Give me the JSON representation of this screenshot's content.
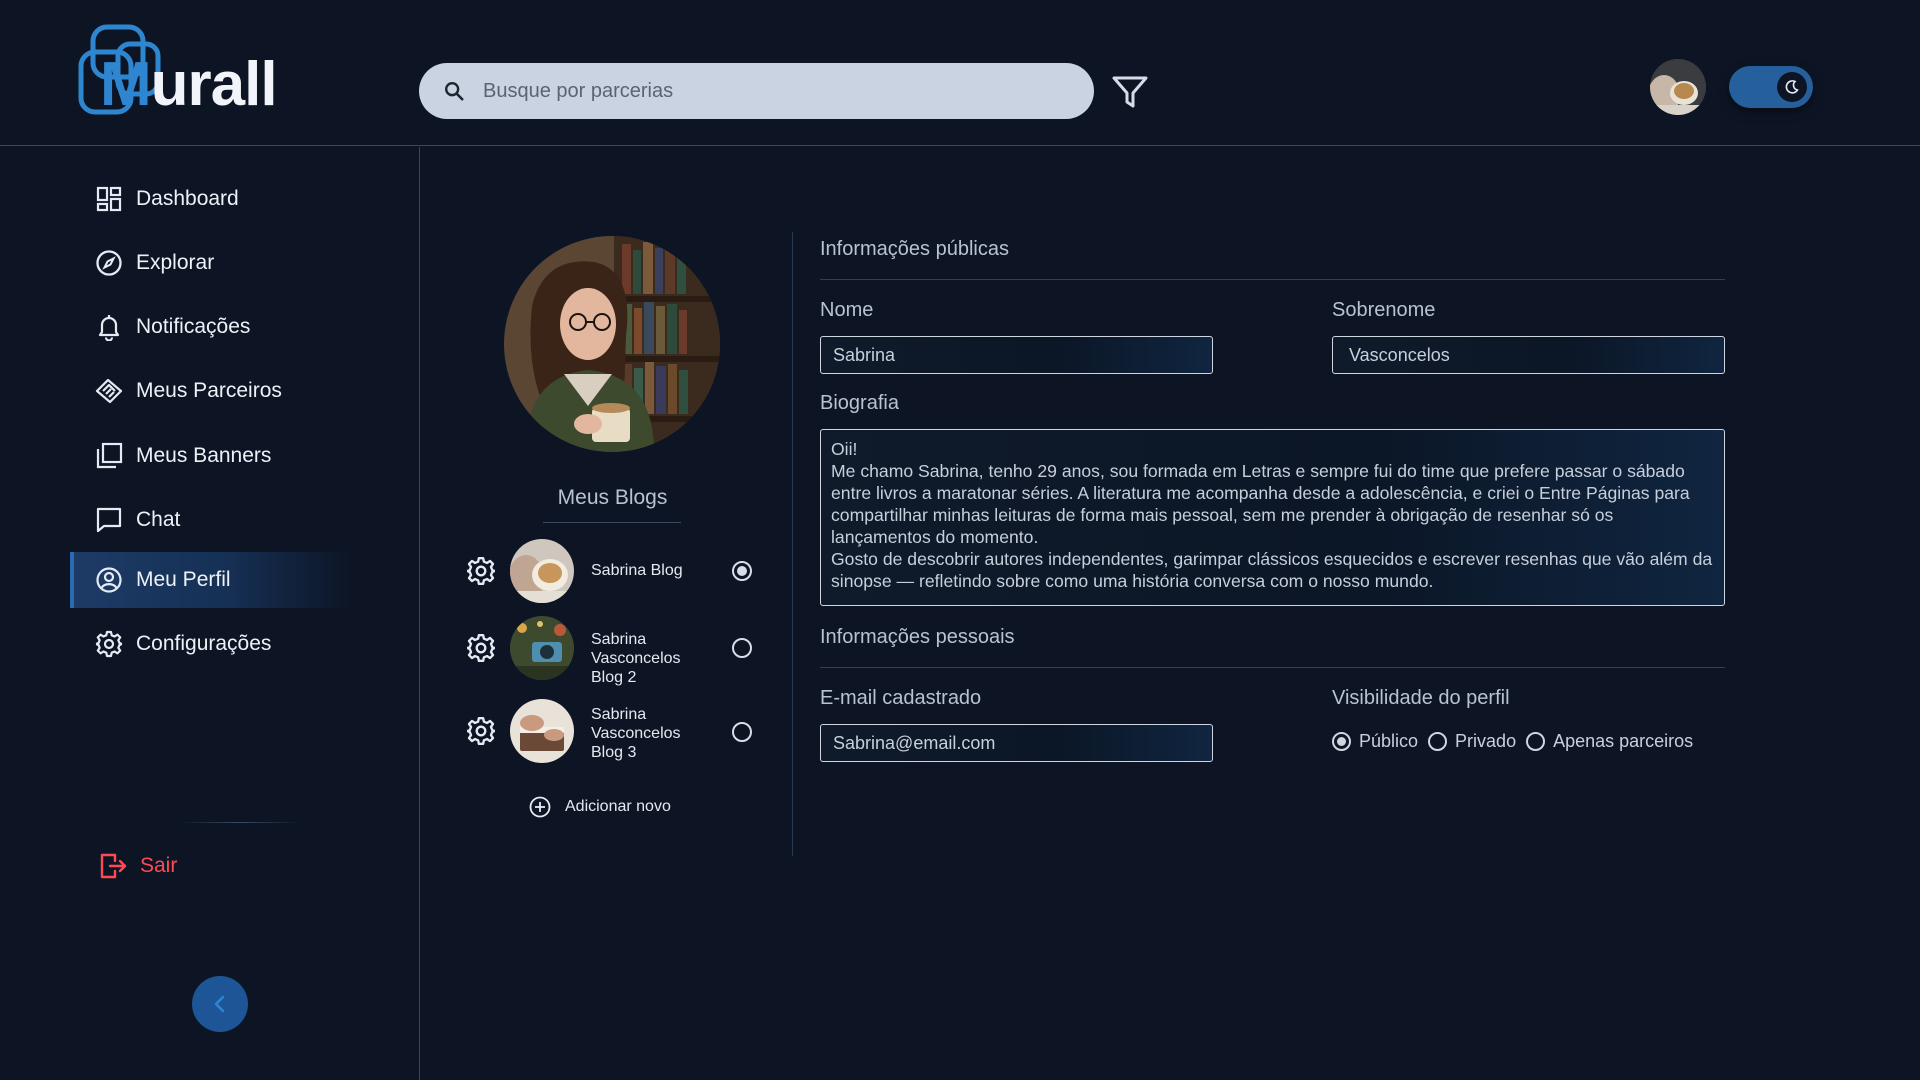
{
  "header": {
    "logo_first": "M",
    "logo_rest": "urall",
    "search_placeholder": "Busque por parcerias"
  },
  "sidebar": {
    "items": [
      {
        "label": "Dashboard",
        "icon": "dashboard-icon"
      },
      {
        "label": "Explorar",
        "icon": "compass-icon"
      },
      {
        "label": "Notificações",
        "icon": "bell-icon"
      },
      {
        "label": "Meus Parceiros",
        "icon": "handshake-icon"
      },
      {
        "label": "Meus Banners",
        "icon": "banners-icon"
      },
      {
        "label": "Chat",
        "icon": "chat-icon"
      },
      {
        "label": "Meu Perfil",
        "icon": "user-circle-icon",
        "active": true
      },
      {
        "label": "Configurações",
        "icon": "gear-icon"
      }
    ],
    "logout_label": "Sair"
  },
  "blogs": {
    "title": "Meus Blogs",
    "items": [
      {
        "name": "Sabrina Blog",
        "selected": true
      },
      {
        "name": "Sabrina Vasconcelos Blog 2",
        "selected": false
      },
      {
        "name": "Sabrina Vasconcelos Blog 3",
        "selected": false
      }
    ],
    "add_label": "Adicionar novo"
  },
  "form": {
    "public_title": "Informações públicas",
    "first_name_label": "Nome",
    "first_name_value": "Sabrina",
    "last_name_label": "Sobrenome",
    "last_name_value": "Vasconcelos",
    "bio_label": "Biografia",
    "bio_value": "Oii!\nMe chamo Sabrina, tenho 29 anos, sou formada em Letras e sempre fui do time que prefere passar o sábado entre livros a maratonar séries. A literatura me acompanha desde a adolescência, e criei o Entre Páginas para compartilhar minhas leituras de forma mais pessoal, sem me prender à obrigação de resenhar só os lançamentos do momento.\nGosto de descobrir autores independentes, garimpar clássicos esquecidos e escrever resenhas que vão além da sinopse — refletindo sobre como uma história conversa com o nosso mundo.",
    "personal_title": "Informações pessoais",
    "email_label": "E-mail cadastrado",
    "email_value": "Sabrina@email.com",
    "visibility_label": "Visibilidade do perfil",
    "visibility_options": [
      "Público",
      "Privado",
      "Apenas parceiros"
    ],
    "visibility_selected": "Público"
  },
  "colors": {
    "background": "#0d1525",
    "accent": "#2f86d0",
    "danger": "#ff4a55",
    "active_nav": "#1c3b66"
  }
}
